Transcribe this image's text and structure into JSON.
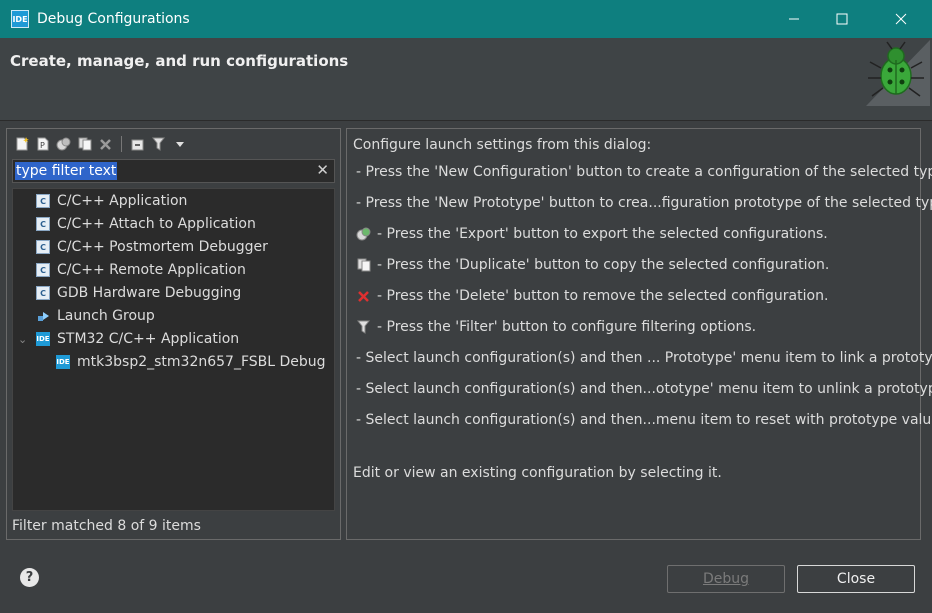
{
  "window": {
    "app_icon": "IDE",
    "title": "Debug Configurations",
    "minimize_icon": "minimize-icon",
    "maximize_icon": "maximize-icon",
    "close_icon": "close-icon"
  },
  "header": {
    "heading": "Create, manage, and run configurations",
    "image_icon": "bug-icon"
  },
  "toolbar": {
    "buttons": [
      {
        "name": "new-configuration",
        "icon": "new-file-icon"
      },
      {
        "name": "new-prototype",
        "icon": "new-prototype-icon"
      },
      {
        "name": "export",
        "icon": "export-icon"
      },
      {
        "name": "duplicate",
        "icon": "duplicate-icon"
      },
      {
        "name": "delete",
        "icon": "delete-icon"
      },
      {
        "name": "collapse-all",
        "icon": "collapse-all-icon"
      },
      {
        "name": "filter",
        "icon": "filter-icon"
      },
      {
        "name": "view-menu",
        "icon": "dropdown-arrow-icon"
      }
    ]
  },
  "filter": {
    "value": "type filter text",
    "clear_icon": "clear-icon"
  },
  "tree": {
    "items": [
      {
        "label": "C/C++ Application",
        "icon": "c-icon"
      },
      {
        "label": "C/C++ Attach to Application",
        "icon": "c-icon"
      },
      {
        "label": "C/C++ Postmortem Debugger",
        "icon": "c-icon"
      },
      {
        "label": "C/C++ Remote Application",
        "icon": "c-icon"
      },
      {
        "label": "GDB Hardware Debugging",
        "icon": "c-icon"
      },
      {
        "label": "Launch Group",
        "icon": "launch-group-icon"
      },
      {
        "label": "STM32 C/C++ Application",
        "icon": "ide-icon",
        "expanded": true
      },
      {
        "label": "mtk3bsp2_stm32n657_FSBL Debug",
        "icon": "ide-icon",
        "child": true
      }
    ]
  },
  "filter_status": "Filter matched 8 of 9 items",
  "info": {
    "intro": "Configure launch settings from this dialog:",
    "lines": [
      {
        "text": "- Press the 'New Configuration' button to create a configuration of the selected type.",
        "icon": ""
      },
      {
        "text": "- Press the 'New Prototype' button to crea...figuration prototype of the selected type.",
        "icon": ""
      },
      {
        "text": "- Press the 'Export' button to export the selected configurations.",
        "icon": "export-icon"
      },
      {
        "text": "- Press the 'Duplicate' button to copy the selected configuration.",
        "icon": "duplicate-icon"
      },
      {
        "text": "- Press the 'Delete' button to remove the selected configuration.",
        "icon": "delete-icon"
      },
      {
        "text": "- Press the 'Filter' button to configure filtering options.",
        "icon": "filter-icon"
      },
      {
        "text": "- Select launch configuration(s) and then ... Prototype' menu item to link a prototype.",
        "icon": ""
      },
      {
        "text": "- Select launch configuration(s) and then...ototype' menu item to unlink a prototype.",
        "icon": ""
      },
      {
        "text": "- Select launch configuration(s) and then...menu item to reset with prototype values.",
        "icon": ""
      }
    ],
    "footer": "Edit or view an existing configuration by selecting it."
  },
  "buttons": {
    "help_icon": "help-icon",
    "debug": "Debug",
    "close": "Close"
  },
  "colors": {
    "titlebar": "#0e7f7f",
    "background": "#3c3f41",
    "selection": "#2f65ca"
  }
}
